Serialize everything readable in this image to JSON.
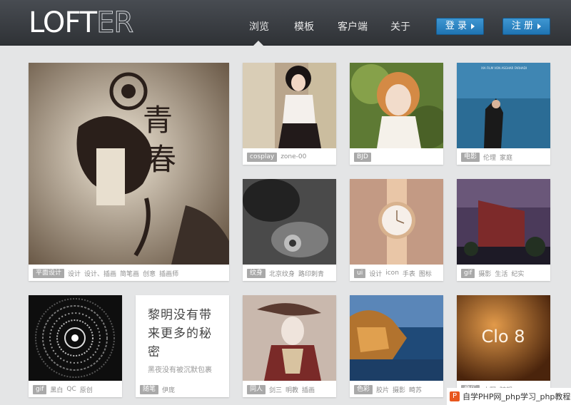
{
  "header": {
    "logo_bold": "LOFT",
    "logo_thin": "ER",
    "nav": [
      "浏览",
      "模板",
      "客户端",
      "关于"
    ],
    "login_label": "登 录",
    "register_label": "注 册"
  },
  "posts": [
    {
      "tag": "平面设计",
      "tags": [
        "设计",
        "设计、插画",
        "简笔画",
        "创意",
        "插画师"
      ]
    },
    {
      "tag": "cosplay",
      "tags": [
        "zone-00"
      ]
    },
    {
      "tag": "BJD",
      "tags": []
    },
    {
      "tag": "电影",
      "tags": [
        "伦理",
        "家庭"
      ],
      "overlay_text": "XIA FILM VON ASGHAR FARHADI"
    },
    {
      "tag": "纹身",
      "tags": [
        "北京纹身",
        "路印刺青"
      ]
    },
    {
      "tag": "ui",
      "tags": [
        "设计",
        "icon",
        "手表",
        "图标"
      ]
    },
    {
      "tag": "gif",
      "tags": [
        "摄影",
        "生活",
        "纪实"
      ]
    },
    {
      "tag": "gif",
      "tags": [
        "黑白",
        "QC",
        "原创"
      ]
    },
    {
      "tag": "随笔",
      "tags": [
        "伊庞"
      ],
      "title": "黎明没有带来更多的秘密",
      "excerpt": "黑夜没有被沉默包裹"
    },
    {
      "tag": "同人",
      "tags": [
        "剑三",
        "明教",
        "插画"
      ]
    },
    {
      "tag": "色彩",
      "tags": [
        "胶片",
        "摄影",
        "畸苏"
      ]
    },
    {
      "tag": "音乐",
      "tags": [
        "小野",
        "随想"
      ],
      "overlay_text": "Clo 8"
    }
  ],
  "watermark": {
    "text": "自学PHP网_php学习_php教程"
  },
  "colors": {
    "header_bg": "#2f3236",
    "button_blue": "#1f74b3",
    "page_bg": "#e4e5e6"
  }
}
